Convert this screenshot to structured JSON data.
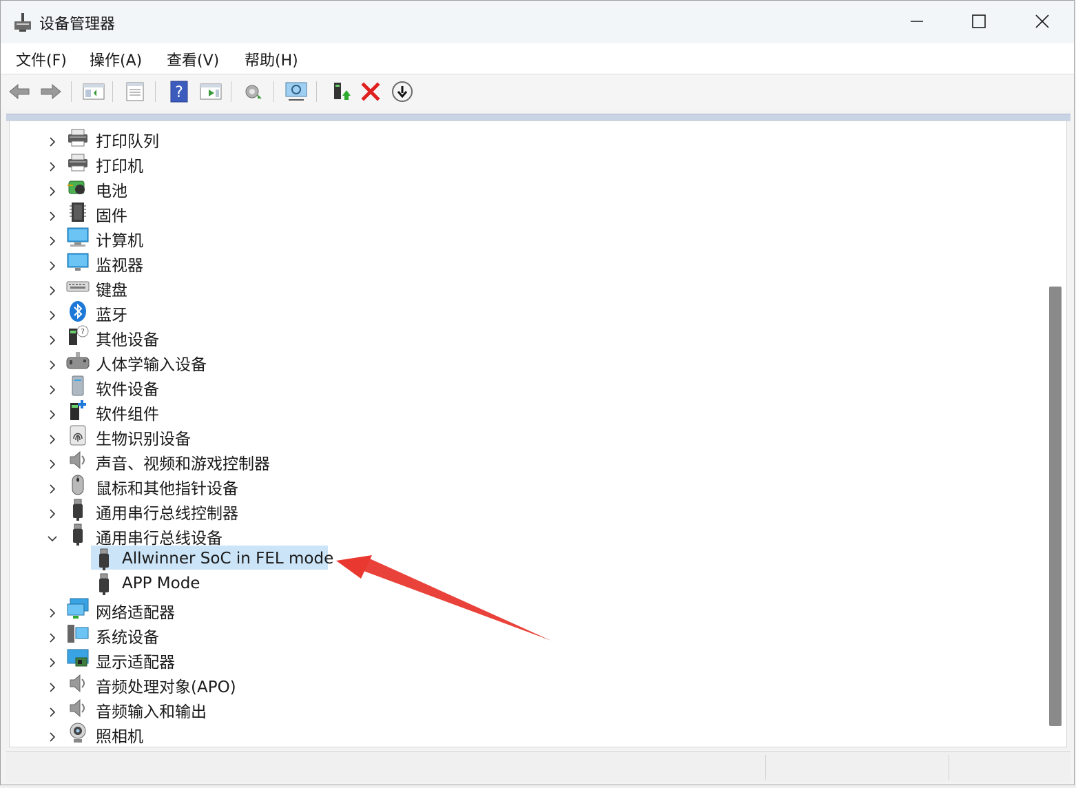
{
  "window": {
    "title": "设备管理器"
  },
  "menu": [
    "文件(F)",
    "操作(A)",
    "查看(V)",
    "帮助(H)"
  ],
  "toolbar_icons": [
    "back-icon",
    "forward-icon",
    "show-hide-tree-icon",
    "properties-icon",
    "help-icon",
    "run-icon",
    "scan-hardware-icon",
    "display-icon",
    "update-driver-icon",
    "uninstall-icon",
    "disable-icon"
  ],
  "tree": {
    "categories_top": [
      {
        "label": "打印队列",
        "icon": "print-queue-icon"
      },
      {
        "label": "打印机",
        "icon": "printer-icon"
      },
      {
        "label": "电池",
        "icon": "battery-icon"
      },
      {
        "label": "固件",
        "icon": "firmware-icon"
      },
      {
        "label": "计算机",
        "icon": "computer-icon"
      },
      {
        "label": "监视器",
        "icon": "monitor-icon"
      },
      {
        "label": "键盘",
        "icon": "keyboard-icon"
      },
      {
        "label": "蓝牙",
        "icon": "bluetooth-icon"
      },
      {
        "label": "其他设备",
        "icon": "other-devices-icon"
      },
      {
        "label": "人体学输入设备",
        "icon": "hid-icon"
      },
      {
        "label": "软件设备",
        "icon": "software-device-icon"
      },
      {
        "label": "软件组件",
        "icon": "software-component-icon"
      },
      {
        "label": "生物识别设备",
        "icon": "biometric-icon"
      },
      {
        "label": "声音、视频和游戏控制器",
        "icon": "sound-icon"
      },
      {
        "label": "鼠标和其他指针设备",
        "icon": "mouse-icon"
      },
      {
        "label": "通用串行总线控制器",
        "icon": "usb-icon"
      }
    ],
    "expanded": {
      "label": "通用串行总线设备",
      "icon": "usb-icon"
    },
    "children": [
      {
        "label": "Allwinner SoC in FEL mode",
        "icon": "usb-device-icon"
      },
      {
        "label": "APP Mode",
        "icon": "usb-device-icon"
      }
    ],
    "categories_bottom": [
      {
        "label": "网络适配器",
        "icon": "network-icon"
      },
      {
        "label": "系统设备",
        "icon": "system-icon"
      },
      {
        "label": "显示适配器",
        "icon": "display-adapter-icon"
      },
      {
        "label": "音频处理对象(APO)",
        "icon": "audio-icon"
      },
      {
        "label": "音频输入和输出",
        "icon": "audio-icon"
      },
      {
        "label": "照相机",
        "icon": "camera-icon"
      }
    ]
  },
  "colors": {
    "selection": "#cce4f7",
    "annotation_arrow": "#e8382f"
  }
}
